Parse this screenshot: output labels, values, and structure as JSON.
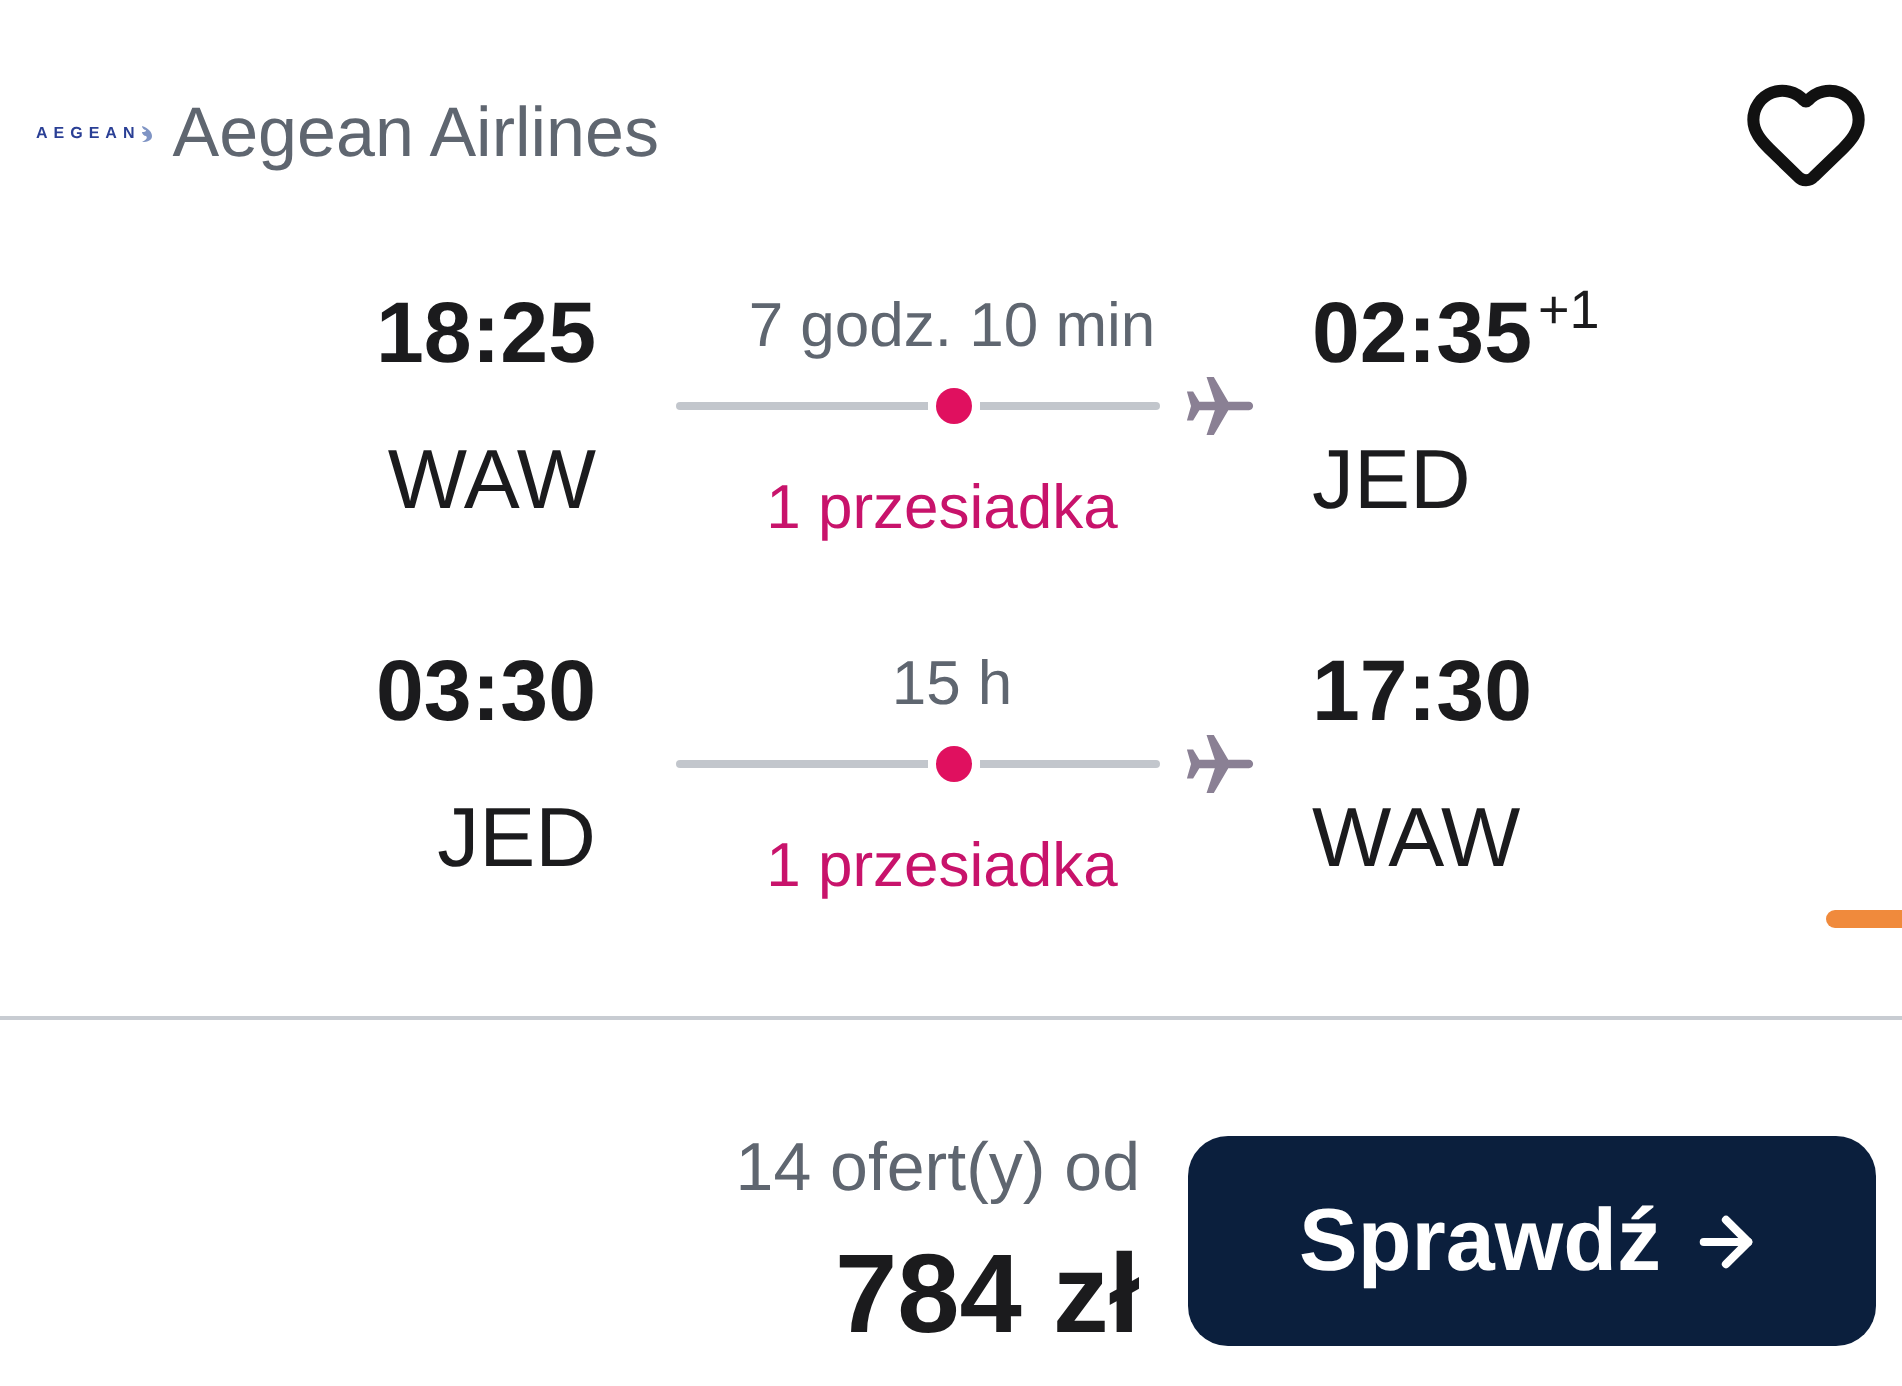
{
  "airline": {
    "logo_text": "AEGEAN",
    "name": "Aegean Airlines"
  },
  "favorite": {
    "selected": false
  },
  "legs": [
    {
      "departure": {
        "time": "18:25",
        "airport": "WAW"
      },
      "duration": "7 godz. 10 min",
      "stops": "1 przesiadka",
      "arrival": {
        "time": "02:35",
        "day_offset": "+1",
        "airport": "JED"
      }
    },
    {
      "departure": {
        "time": "03:30",
        "airport": "JED"
      },
      "duration": "15 h",
      "stops": "1 przesiadka",
      "arrival": {
        "time": "17:30",
        "airport": "WAW"
      }
    }
  ],
  "offers": {
    "count": "14 ofert(y) od",
    "price": "784 zł"
  },
  "check_button": {
    "label": "Sprawdź"
  }
}
